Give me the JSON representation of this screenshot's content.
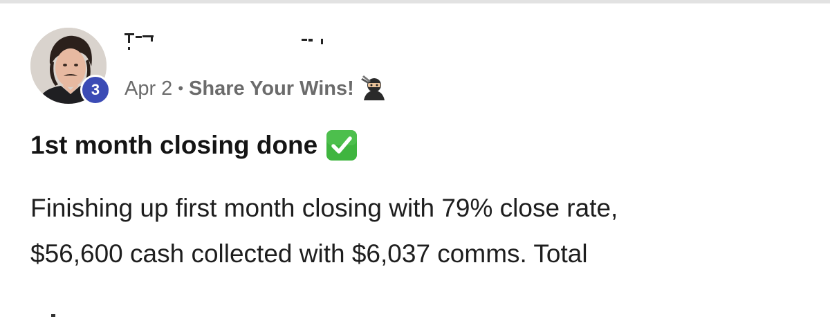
{
  "post": {
    "author": {
      "level": "3",
      "name_visible": "",
      "avatar_icon": "user-avatar-photo"
    },
    "meta": {
      "date": "Apr 2",
      "separator": "•",
      "category": "Share Your Wins!",
      "category_icon": "ninja-icon"
    },
    "title": "1st month closing done",
    "title_icon": "check-mark-button-icon",
    "body_lines": [
      "Finishing up first month closing with 79% close rate,",
      "$56,600 cash collected with $6,037 comms. Total"
    ]
  },
  "colors": {
    "badge": "#3b4bb5",
    "check_green": "#3fb53f",
    "meta_gray": "#6b6b6b",
    "divider": "#e2e2e2"
  }
}
